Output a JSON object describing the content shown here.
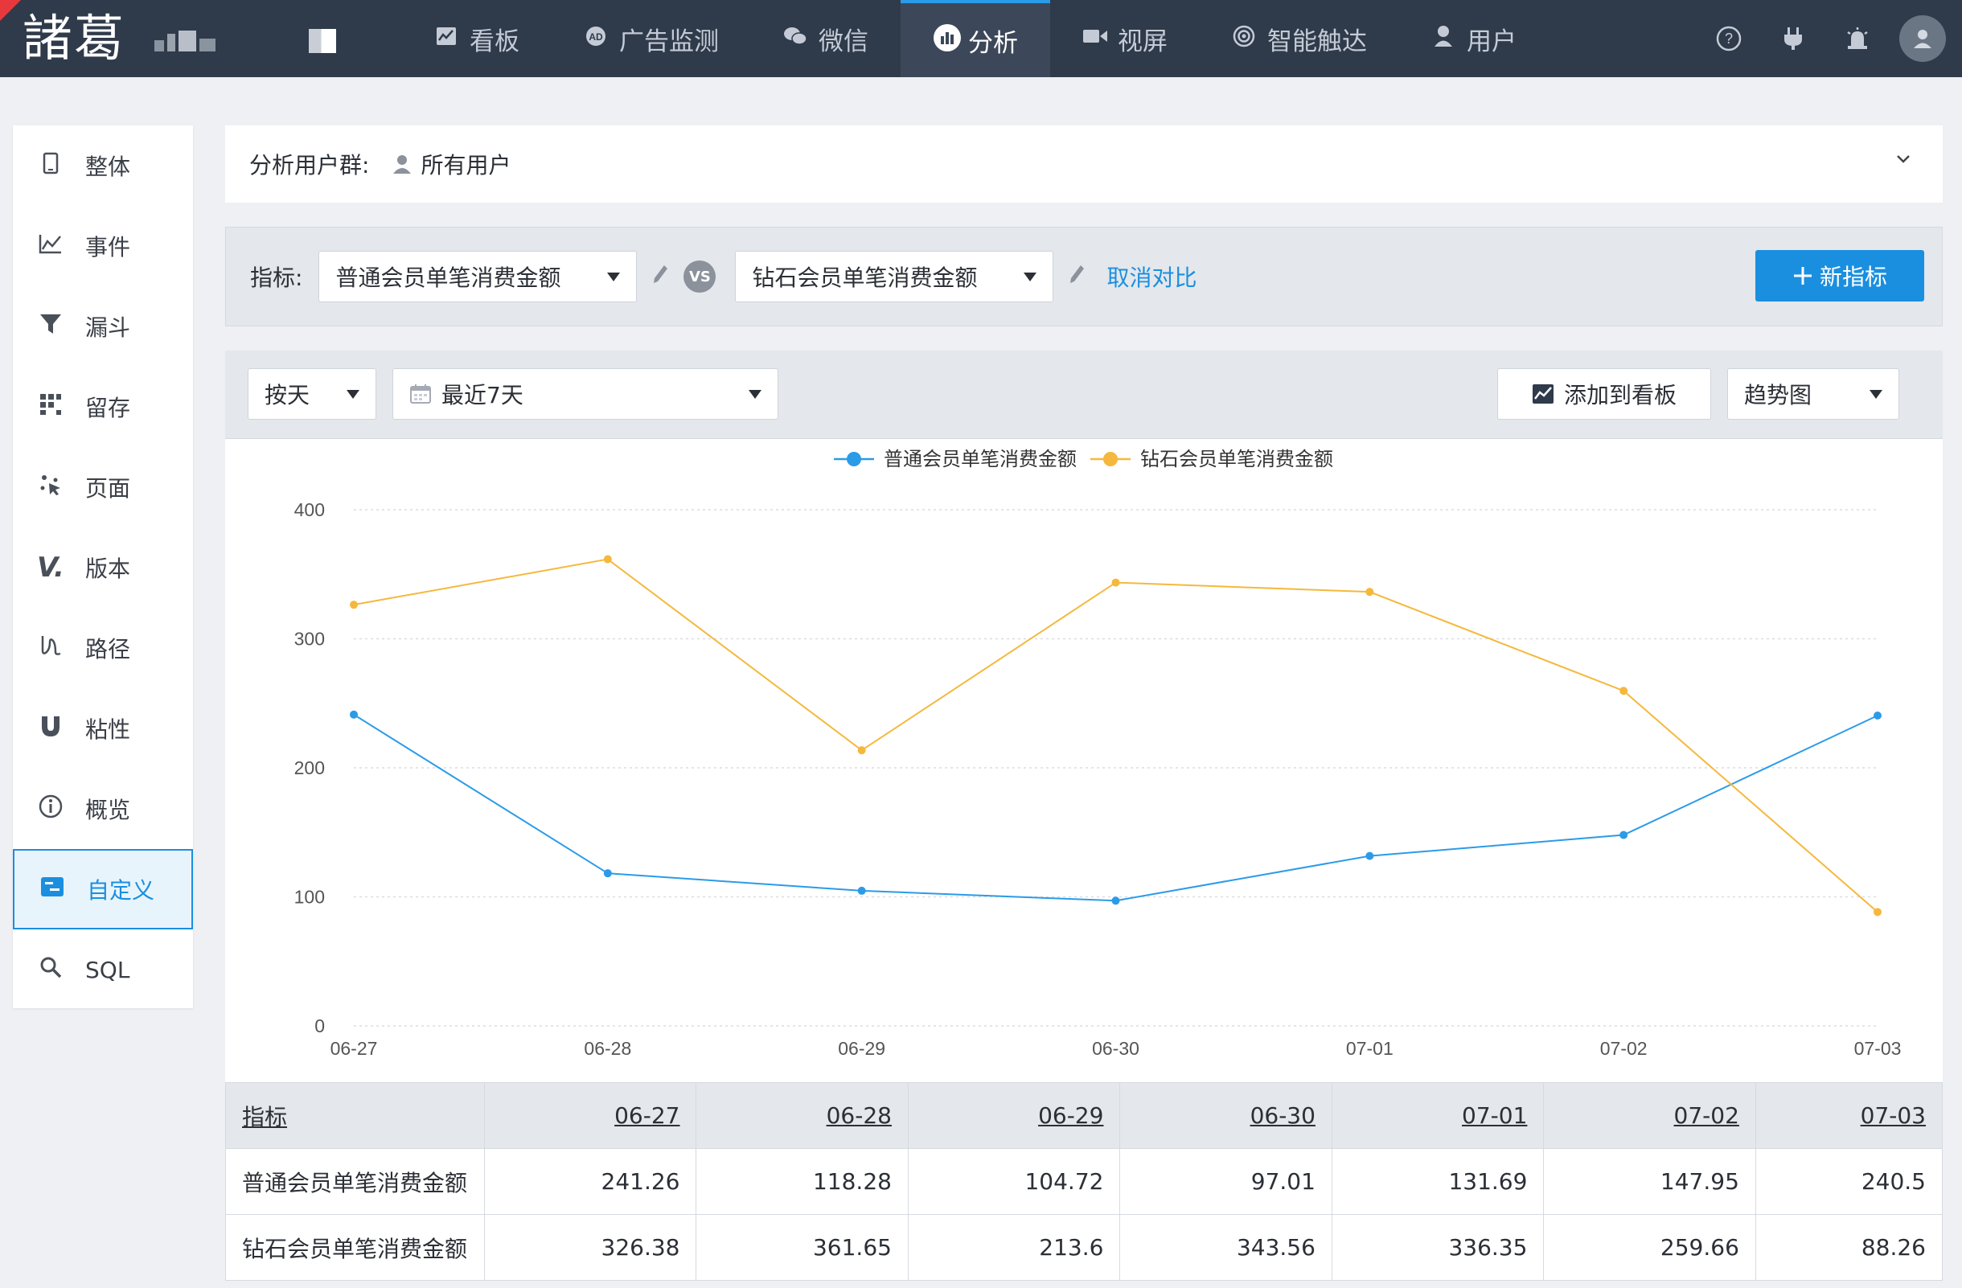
{
  "app": {
    "logo_text": "諸葛"
  },
  "nav": [
    {
      "label": "看板",
      "icon": "chart-board-icon"
    },
    {
      "label": "广告监测",
      "icon": "ad-icon"
    },
    {
      "label": "微信",
      "icon": "wechat-icon"
    },
    {
      "label": "分析",
      "icon": "analysis-icon",
      "active": true
    },
    {
      "label": "视屏",
      "icon": "video-icon"
    },
    {
      "label": "智能触达",
      "icon": "target-icon"
    },
    {
      "label": "用户",
      "icon": "user-icon"
    }
  ],
  "sidebar": [
    {
      "label": "整体",
      "icon": "phone-icon"
    },
    {
      "label": "事件",
      "icon": "line-chart-icon"
    },
    {
      "label": "漏斗",
      "icon": "funnel-icon"
    },
    {
      "label": "留存",
      "icon": "grid-icon"
    },
    {
      "label": "页面",
      "icon": "sparkle-icon"
    },
    {
      "label": "版本",
      "icon": "version-icon"
    },
    {
      "label": "路径",
      "icon": "path-icon"
    },
    {
      "label": "粘性",
      "icon": "magnet-icon"
    },
    {
      "label": "概览",
      "icon": "info-icon"
    },
    {
      "label": "自定义",
      "icon": "custom-icon",
      "active": true
    },
    {
      "label": "SQL",
      "icon": "search-icon"
    }
  ],
  "group": {
    "label": "分析用户群:",
    "value": "所有用户"
  },
  "metrics": {
    "label": "指标:",
    "primary": "普通会员单笔消费金额",
    "vs": "VS",
    "secondary": "钻石会员单笔消费金额",
    "cancel_compare": "取消对比",
    "new_metric": "新指标"
  },
  "toolbar": {
    "granularity": "按天",
    "date_range": "最近7天",
    "add_to_board": "添加到看板",
    "chart_type": "趋势图"
  },
  "colors": {
    "series1": "#2b9be8",
    "series2": "#f5b83d",
    "accent": "#1a8fe0"
  },
  "chart_data": {
    "type": "line",
    "x": [
      "06-27",
      "06-28",
      "06-29",
      "06-30",
      "07-01",
      "07-02",
      "07-03"
    ],
    "ylim": [
      0,
      400
    ],
    "yticks": [
      "0",
      "100",
      "200",
      "300",
      "400"
    ],
    "grid": true,
    "legend": "top-center",
    "series": [
      {
        "name": "普通会员单笔消费金额",
        "color": "#2b9be8",
        "values": [
          241.26,
          118.28,
          104.72,
          97.01,
          131.69,
          147.95,
          240.5
        ]
      },
      {
        "name": "钻石会员单笔消费金额",
        "color": "#f5b83d",
        "values": [
          326.38,
          361.65,
          213.6,
          343.56,
          336.35,
          259.66,
          88.26
        ]
      }
    ]
  },
  "table": {
    "header_first": "指标",
    "columns": [
      "06-27",
      "06-28",
      "06-29",
      "06-30",
      "07-01",
      "07-02",
      "07-03"
    ],
    "rows": [
      {
        "name": "普通会员单笔消费金额",
        "values": [
          "241.26",
          "118.28",
          "104.72",
          "97.01",
          "131.69",
          "147.95",
          "240.5"
        ]
      },
      {
        "name": "钻石会员单笔消费金额",
        "values": [
          "326.38",
          "361.65",
          "213.6",
          "343.56",
          "336.35",
          "259.66",
          "88.26"
        ]
      }
    ]
  }
}
